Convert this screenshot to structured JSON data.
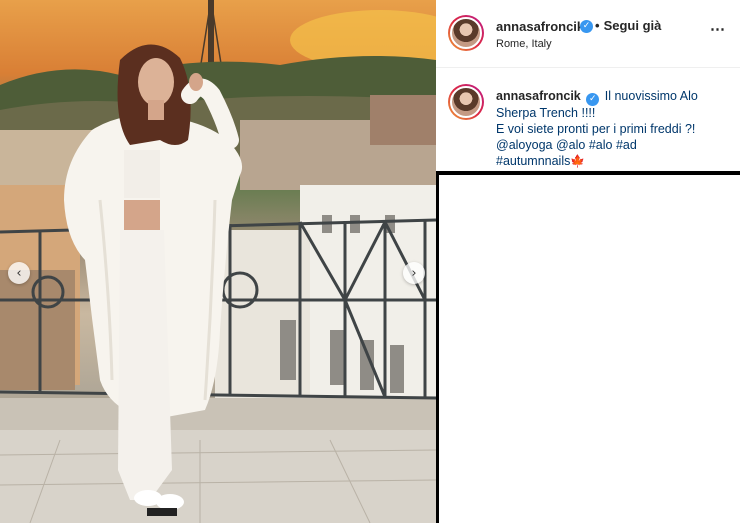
{
  "post": {
    "username": "annasafroncik",
    "follow_label": "Segui già",
    "location": "Rome, Italy",
    "more_icon": "⋯"
  },
  "caption": {
    "username": "annasafroncik",
    "line1": "Il nuovissimo Alo",
    "line2": "Sherpa Trench !!!!",
    "line3": "E voi siete pronti per i primi freddi ?!",
    "tags": [
      "@aloyoga",
      "@alo",
      "#alo",
      "#ad",
      "#autumnnails"
    ],
    "emoji": "🍁"
  },
  "carousel": {
    "prev_icon": "‹",
    "next_icon": "›"
  },
  "colors": {
    "verified": "#3897f0",
    "link": "#00376b",
    "text": "#262626"
  }
}
